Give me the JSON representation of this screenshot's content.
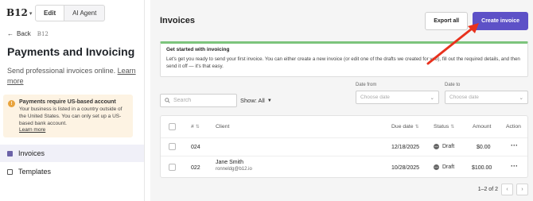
{
  "brand": {
    "logo_text": "B12",
    "logo_mini": "B12"
  },
  "mode_tabs": [
    {
      "label": "Edit",
      "active": true
    },
    {
      "label": "AI Agent",
      "active": false
    }
  ],
  "sidebar": {
    "back_label": "Back",
    "page_title": "Payments and Invoicing",
    "subtitle": "Send professional invoices online.",
    "learn_more": "Learn more",
    "warning": {
      "title": "Payments require US-based account",
      "body": "Your business is listed in a country outside of the United States. You can only set up a US-based bank account.",
      "link": "Learn more"
    },
    "nav": [
      {
        "label": "Invoices",
        "active": true
      },
      {
        "label": "Templates",
        "active": false
      }
    ]
  },
  "main": {
    "title": "Invoices",
    "export_label": "Export all",
    "create_label": "Create invoice",
    "banner": {
      "title": "Get started with invoicing",
      "text": "Let's get you ready to send your first invoice. You can either create a new invoice (or edit one of the drafts we created for you), fill out the required details, and then send it off — it's that easy."
    },
    "search_placeholder": "Search",
    "show_filter": "Show: All",
    "date_from": {
      "label": "Date from",
      "placeholder": "Choose date"
    },
    "date_to": {
      "label": "Date to",
      "placeholder": "Choose date"
    },
    "table": {
      "headers": {
        "number": "#",
        "client": "Client",
        "due_date": "Due date",
        "status": "Status",
        "amount": "Amount",
        "action": "Action"
      },
      "rows": [
        {
          "number": "024",
          "client_name": "",
          "client_email": "",
          "due_date": "12/18/2025",
          "status": "Draft",
          "amount": "$0.00"
        },
        {
          "number": "022",
          "client_name": "Jane Smith",
          "client_email": "ronneldg@b12.io",
          "due_date": "10/28/2025",
          "status": "Draft",
          "amount": "$100.00"
        }
      ]
    },
    "pagination": "1–2 of 2"
  },
  "colors": {
    "primary": "#5d51c7",
    "banner_accent": "#7cc47c",
    "warning_bg": "#fdf3e3",
    "annotation_arrow": "#e8321e"
  },
  "icons": [
    "chevron-down-icon",
    "arrow-left-icon",
    "warning-icon",
    "invoice-icon",
    "template-icon",
    "search-icon",
    "calendar-icon",
    "sort-icon",
    "draft-status-icon",
    "more-icon",
    "chevron-left-icon",
    "chevron-right-icon",
    "annotation-arrow"
  ]
}
